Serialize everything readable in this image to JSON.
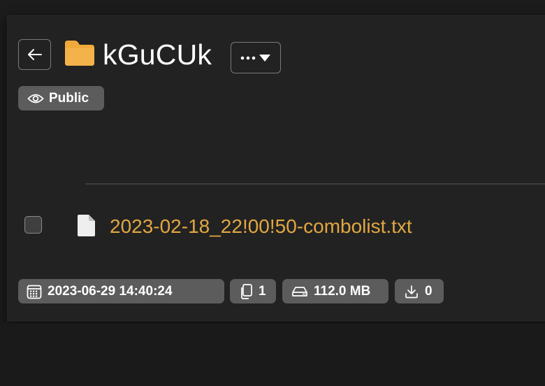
{
  "header": {
    "title": "kGuCUk",
    "back_icon": "arrow-left-icon",
    "folder_icon": "folder-icon",
    "more_icon": "ellipsis-icon",
    "dropdown_icon": "caret-down-icon",
    "folder_color": "#f2a93b"
  },
  "visibility": {
    "label": "Public",
    "icon": "eye-icon"
  },
  "files": [
    {
      "name": "2023-02-18_22!00!50-combolist.txt",
      "icon": "file-icon",
      "checked": false,
      "name_color": "#e2a741"
    }
  ],
  "meta": {
    "date": "2023-06-29 14:40:24",
    "date_icon": "calendar-icon",
    "file_count": "1",
    "file_count_icon": "files-icon",
    "size": "112.0 MB",
    "size_icon": "hard-drive-icon",
    "downloads": "0",
    "downloads_icon": "download-icon"
  }
}
